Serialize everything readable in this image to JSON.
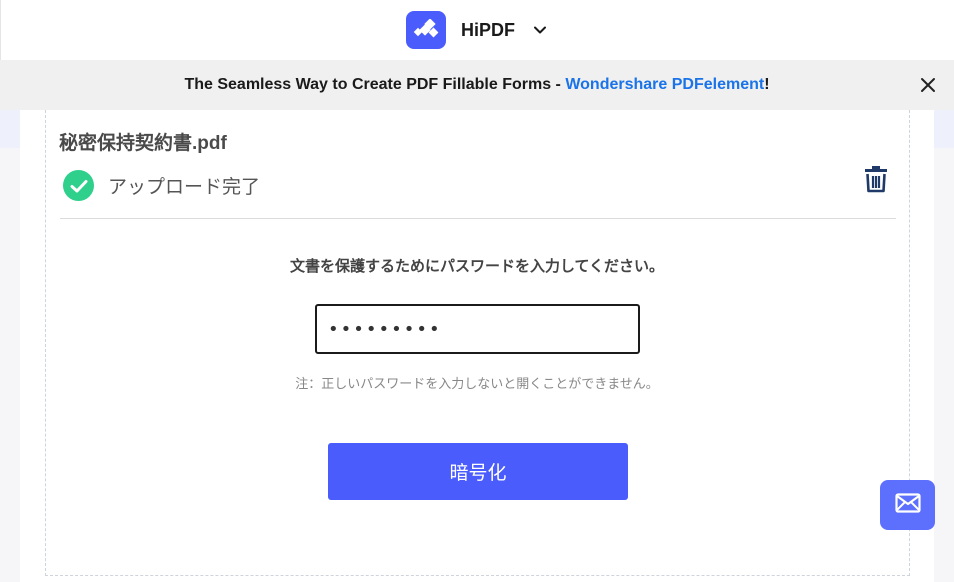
{
  "header": {
    "brand_name": "HiPDF",
    "logo_icon": "hipdf-logo-icon",
    "menu_icon": "chevron-down-icon"
  },
  "banner": {
    "text": "The Seamless Way to Create PDF Fillable Forms - ",
    "link_text": "Wondershare PDFelement",
    "suffix": "!",
    "close_icon": "close-icon"
  },
  "file": {
    "name": "秘密保持契約書.pdf",
    "status": "アップロード完了",
    "status_icon": "check-circle-icon",
    "delete_icon": "trash-icon"
  },
  "form": {
    "prompt": "文書を保護するためにパスワードを入力してください。",
    "password_value": "•••••••••",
    "note": "注：正しいパスワードを入力しないと開くことができません。",
    "submit_label": "暗号化"
  },
  "fab": {
    "icon": "mail-icon"
  },
  "colors": {
    "accent": "#4a5cfc",
    "link": "#1a73e8",
    "success": "#2ed08b",
    "banner_bg": "#f0f0f1"
  }
}
